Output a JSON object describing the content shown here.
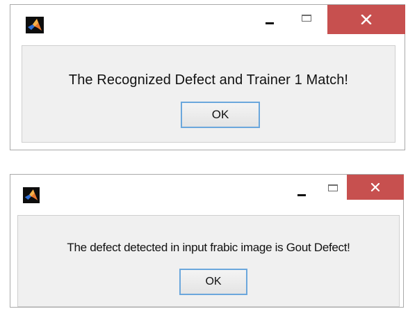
{
  "dialogs": [
    {
      "icon": "matlab-icon",
      "message": "The Recognized Defect and Trainer 1 Match!",
      "ok_label": "OK"
    },
    {
      "icon": "matlab-icon",
      "message": "The defect detected in input frabic image is Gout Defect!",
      "ok_label": "OK"
    }
  ],
  "colors": {
    "close_button": "#c7504f",
    "content_background": "#f0f0f0",
    "ok_button_border": "#6ba7dc"
  }
}
